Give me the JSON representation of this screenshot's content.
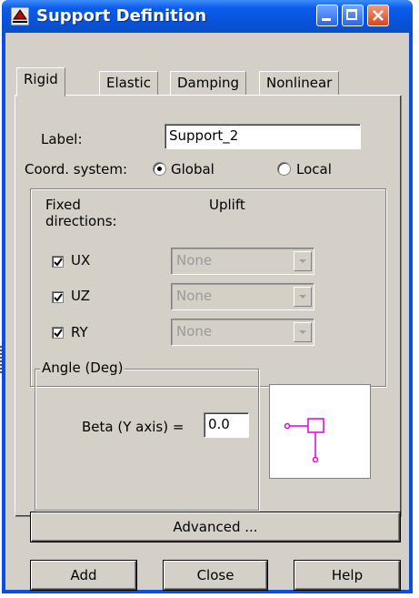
{
  "window": {
    "title": "Support Definition"
  },
  "tabs": [
    "Rigid",
    "Elastic",
    "Damping",
    "Nonlinear"
  ],
  "active_tab": "Rigid",
  "label_field": {
    "label": "Label:",
    "value": "Support_2"
  },
  "coord_system": {
    "label": "Coord. system:",
    "options": [
      "Global",
      "Local"
    ],
    "selected": "Global"
  },
  "fixed_directions": {
    "title": "Fixed directions:",
    "uplift_header": "Uplift",
    "rows": [
      {
        "name": "UX",
        "checked": true,
        "uplift": "None"
      },
      {
        "name": "UZ",
        "checked": true,
        "uplift": "None"
      },
      {
        "name": "RY",
        "checked": true,
        "uplift": "None"
      }
    ]
  },
  "angle": {
    "title": "Angle (Deg)",
    "beta_label": "Beta (Y axis) =",
    "beta_value": "0.0"
  },
  "buttons": {
    "advanced": "Advanced ...",
    "add": "Add",
    "close": "Close",
    "help": "Help"
  },
  "colors": {
    "preview_symbol": "#e000e0",
    "title_bar": "#0b5ced",
    "face": "#d4d0c8"
  }
}
